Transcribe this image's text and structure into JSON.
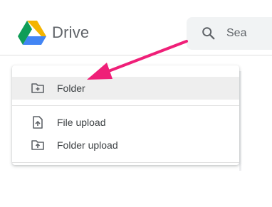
{
  "header": {
    "app_name": "Drive",
    "search_placeholder": "Sea"
  },
  "menu": {
    "items": [
      {
        "label": "Folder",
        "icon": "new-folder-icon",
        "highlighted": true
      },
      {
        "label": "File upload",
        "icon": "file-upload-icon",
        "highlighted": false
      },
      {
        "label": "Folder upload",
        "icon": "folder-upload-icon",
        "highlighted": false
      }
    ]
  },
  "colors": {
    "annotation_arrow": "#ef1f78",
    "logo_green": "#0f9d58",
    "logo_yellow": "#f4b400",
    "logo_blue": "#4285f4",
    "highlight": "#eeeeee"
  }
}
